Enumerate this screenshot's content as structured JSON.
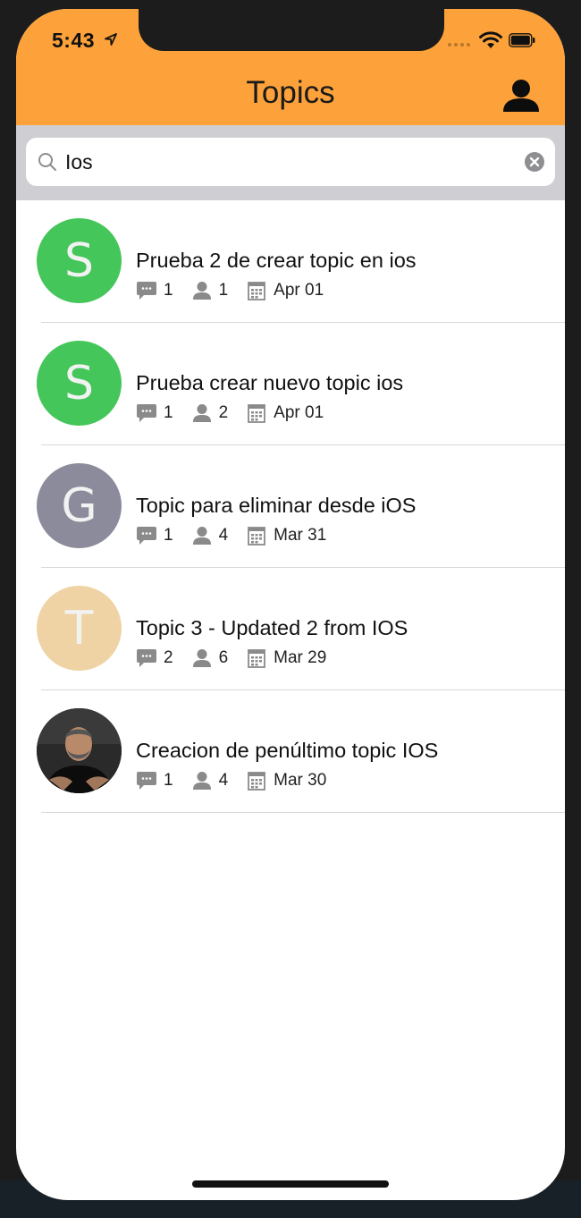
{
  "status_bar": {
    "time": "5:43"
  },
  "nav": {
    "title": "Topics"
  },
  "search": {
    "value": "Ios"
  },
  "colors": {
    "accent": "#fda23a",
    "search_bg": "#cfcfd3"
  },
  "topics": [
    {
      "avatar_letter": "S",
      "avatar_color": "#45c65a",
      "title": "Prueba 2 de crear topic en ios",
      "comments": "1",
      "members": "1",
      "date": "Apr 01"
    },
    {
      "avatar_letter": "S",
      "avatar_color": "#45c65a",
      "title": "Prueba crear nuevo topic ios",
      "comments": "1",
      "members": "2",
      "date": "Apr 01"
    },
    {
      "avatar_letter": "G",
      "avatar_color": "#8b8b9c",
      "title": "Topic para eliminar desde iOS",
      "comments": "1",
      "members": "4",
      "date": "Mar 31"
    },
    {
      "avatar_letter": "T",
      "avatar_color": "#efd3a4",
      "title": "Topic 3 - Updated 2 from IOS",
      "comments": "2",
      "members": "6",
      "date": "Mar 29"
    },
    {
      "avatar_letter": "",
      "avatar_color": "#222222",
      "avatar_photo": true,
      "title": "Creacion de penúltimo topic IOS",
      "comments": "1",
      "members": "4",
      "date": "Mar 30"
    }
  ],
  "icons": {
    "comment": "comment-icon",
    "members": "person-icon",
    "date": "calendar-icon",
    "search": "search-icon",
    "clear": "clear-icon",
    "profile": "profile-icon"
  }
}
